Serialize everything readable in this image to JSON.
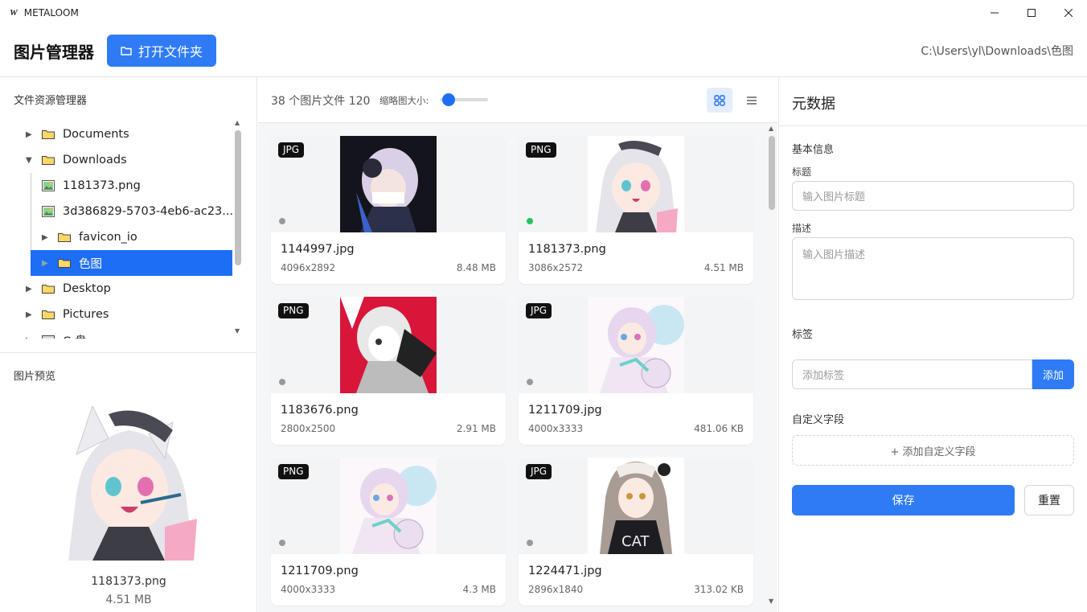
{
  "window": {
    "logo": "W",
    "title": "METALOOM"
  },
  "header": {
    "title": "图片管理器",
    "open_folder_label": "打开文件夹",
    "path": "C:\\Users\\yl\\Downloads\\色图"
  },
  "explorer": {
    "title": "文件资源管理器",
    "items": [
      {
        "label": "Documents",
        "type": "folder",
        "expanded": false
      },
      {
        "label": "Downloads",
        "type": "folder",
        "expanded": true
      },
      {
        "label": "1181373.png",
        "type": "image"
      },
      {
        "label": "3d386829-5703-4eb6-ac23...",
        "type": "image"
      },
      {
        "label": "favicon_io",
        "type": "folder",
        "expanded": false
      },
      {
        "label": "色图",
        "type": "folder",
        "expanded": false,
        "selected": true
      },
      {
        "label": "Desktop",
        "type": "folder",
        "expanded": false
      },
      {
        "label": "Pictures",
        "type": "folder",
        "expanded": false
      },
      {
        "label": "C:盘",
        "type": "drive",
        "expanded": false
      }
    ]
  },
  "preview": {
    "title": "图片预览",
    "name": "1181373.png",
    "size": "4.51 MB"
  },
  "toolbar": {
    "count_text": "38 个图片文件 120",
    "size_label": "缩略图大小:",
    "thumb_size_fraction": 0.1
  },
  "files": [
    {
      "badge": "JPG",
      "name": "1144997.jpg",
      "dims": "4096x2892",
      "size": "8.48 MB",
      "active": false
    },
    {
      "badge": "PNG",
      "name": "1181373.png",
      "dims": "3086x2572",
      "size": "4.51 MB",
      "active": true
    },
    {
      "badge": "PNG",
      "name": "1183676.png",
      "dims": "2800x2500",
      "size": "2.91 MB",
      "active": false
    },
    {
      "badge": "JPG",
      "name": "1211709.jpg",
      "dims": "4000x3333",
      "size": "481.06 KB",
      "active": false
    },
    {
      "badge": "PNG",
      "name": "1211709.png",
      "dims": "4000x3333",
      "size": "4.3 MB",
      "active": false
    },
    {
      "badge": "JPG",
      "name": "1224471.jpg",
      "dims": "2896x1840",
      "size": "313.02 KB",
      "active": false
    }
  ],
  "metadata": {
    "title": "元数据",
    "basic_info": "基本信息",
    "title_label": "标题",
    "title_placeholder": "输入图片标题",
    "desc_label": "描述",
    "desc_placeholder": "输入图片描述",
    "tags_label": "标签",
    "tag_placeholder": "添加标签",
    "add_tag_label": "添加",
    "custom_fields_label": "自定义字段",
    "add_custom_field_label": "+ 添加自定义字段",
    "save_label": "保存",
    "reset_label": "重置"
  },
  "colors": {
    "accent": "#2f7bf5",
    "selected": "#1e6ef5",
    "active_dot": "#22c55e"
  }
}
